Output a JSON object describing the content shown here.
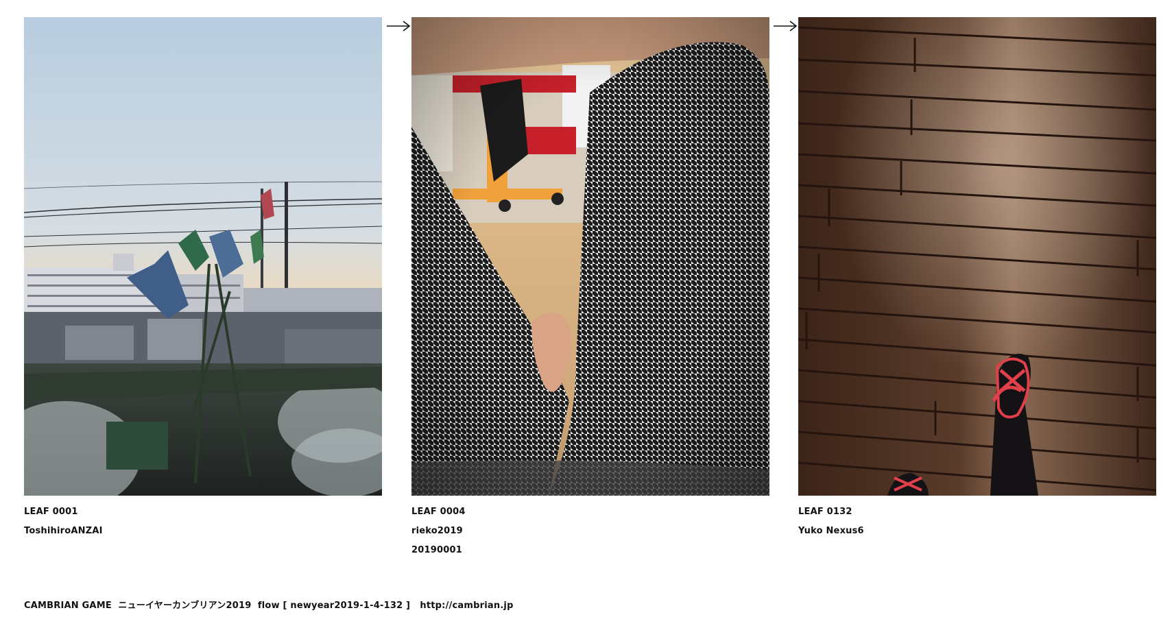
{
  "leaves": [
    {
      "label": "LEAF 0001",
      "lines": [
        "ToshihiroANZAI"
      ]
    },
    {
      "label": "LEAF 0004",
      "lines": [
        "rieko2019",
        "20190001"
      ]
    },
    {
      "label": "LEAF 0132",
      "lines": [
        "Yuko Nexus6"
      ]
    }
  ],
  "footer": {
    "game": "CAMBRIAN GAME",
    "title": "ニューイヤーカンブリアン2019",
    "flow": "flow [ newyear2019-1-4-132 ]",
    "url": "http://cambrian.jp"
  },
  "arrow_icon": "right-arrow-icon",
  "accent_colors": {
    "text": "#111111",
    "background": "#ffffff"
  }
}
